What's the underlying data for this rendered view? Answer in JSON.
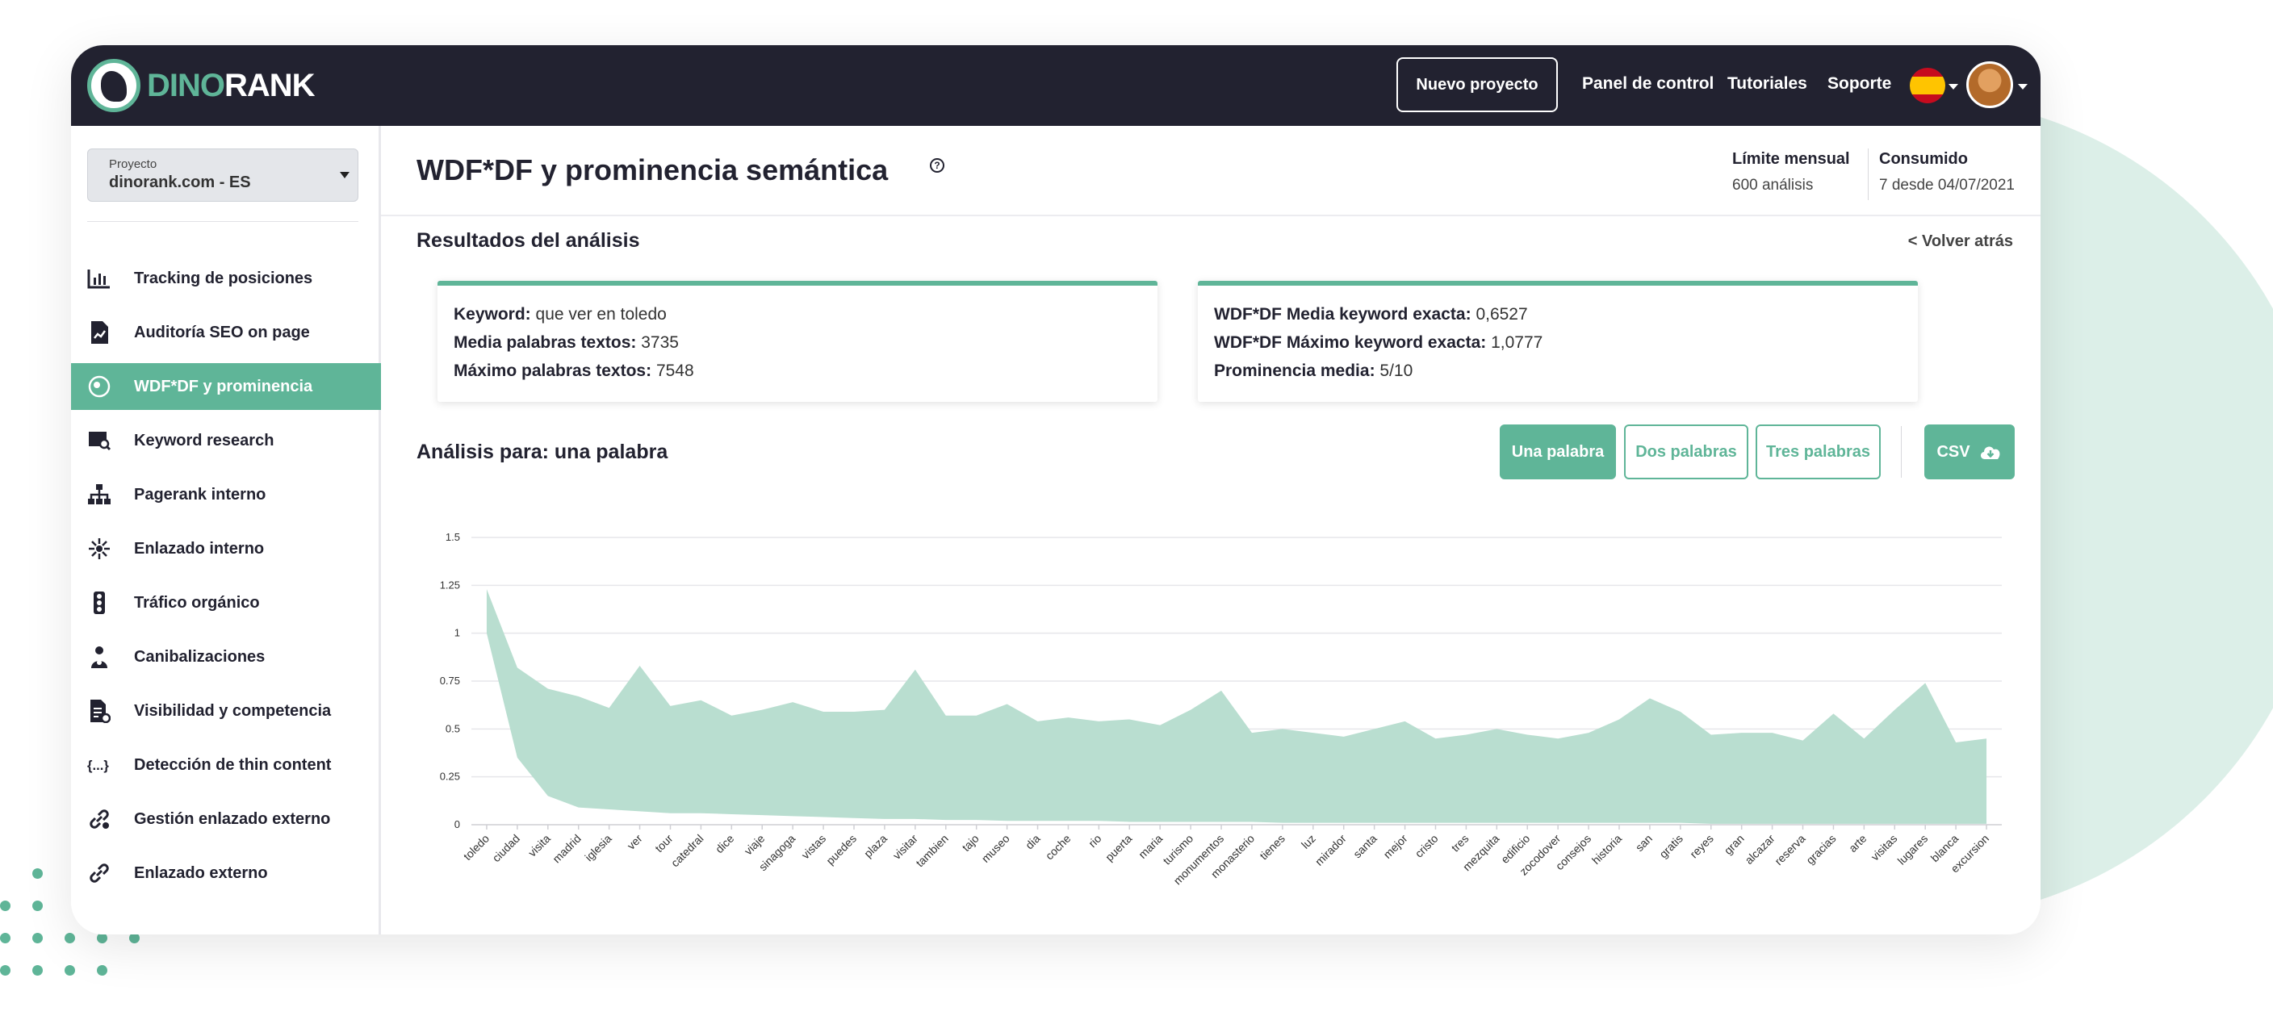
{
  "brand": {
    "logo_part_a": "DINO",
    "logo_part_b": "RANK",
    "accent": "#5fb598",
    "dark": "#222230"
  },
  "topbar": {
    "new_project": "Nuevo proyecto",
    "links": [
      "Panel de control",
      "Tutoriales",
      "Soporte"
    ],
    "icons": [
      "spain-flag-icon",
      "user-avatar"
    ]
  },
  "project": {
    "label": "Proyecto",
    "value": "dinorank.com - ES"
  },
  "sidebar": {
    "items": [
      {
        "label": "Tracking de posiciones",
        "icon": "bar-chart-icon"
      },
      {
        "label": "Auditoría SEO on page",
        "icon": "document-chart-icon"
      },
      {
        "label": "WDF*DF y prominencia",
        "icon": "target-icon",
        "active": true
      },
      {
        "label": "Keyword research",
        "icon": "search-chart-icon"
      },
      {
        "label": "Pagerank interno",
        "icon": "sitemap-icon"
      },
      {
        "label": "Enlazado interno",
        "icon": "network-icon"
      },
      {
        "label": "Tráfico orgánico",
        "icon": "traffic-light-icon"
      },
      {
        "label": "Canibalizaciones",
        "icon": "people-icon"
      },
      {
        "label": "Visibilidad y competencia",
        "icon": "report-icon"
      },
      {
        "label": "Detección de thin content",
        "icon": "braces-icon"
      },
      {
        "label": "Gestión enlazado externo",
        "icon": "link-gear-icon"
      },
      {
        "label": "Enlazado externo",
        "icon": "link-icon"
      }
    ]
  },
  "header": {
    "title": "WDF*DF y prominencia semántica",
    "help_icon": "?",
    "limit_label": "Límite mensual",
    "limit_value": "600 análisis",
    "consumed_label": "Consumido",
    "consumed_value": "7 desde 04/07/2021"
  },
  "results": {
    "title": "Resultados del análisis",
    "back": "< Volver atrás",
    "card1": [
      {
        "label": "Keyword:",
        "value": "que ver en toledo"
      },
      {
        "label": "Media palabras textos:",
        "value": "3735"
      },
      {
        "label": "Máximo palabras textos:",
        "value": "7548"
      }
    ],
    "card2": [
      {
        "label": "WDF*DF Media keyword exacta:",
        "value": "0,6527"
      },
      {
        "label": "WDF*DF Máximo keyword exacta:",
        "value": "1,0777"
      },
      {
        "label": "Prominencia media:",
        "value": "5/10"
      }
    ]
  },
  "analysis": {
    "title": "Análisis para: una palabra",
    "buttons": [
      {
        "label": "Una palabra",
        "selected": true
      },
      {
        "label": "Dos palabras",
        "selected": false
      },
      {
        "label": "Tres palabras",
        "selected": false
      }
    ],
    "csv_label": "CSV",
    "csv_icon": "cloud-download-icon"
  },
  "chart_data": {
    "type": "area",
    "ylim": [
      0,
      1.5
    ],
    "yticks": [
      "0",
      "0.25",
      "0.5",
      "0.75",
      "1",
      "1.25",
      "1.5"
    ],
    "ytick_values": [
      0,
      0.25,
      0.5,
      0.75,
      1,
      1.25,
      1.5
    ],
    "categories": [
      "toledo",
      "ciudad",
      "visita",
      "madrid",
      "iglesia",
      "ver",
      "tour",
      "catedral",
      "dice",
      "viaje",
      "sinagoga",
      "vistas",
      "puedes",
      "plaza",
      "visitar",
      "tambien",
      "tajo",
      "museo",
      "dia",
      "coche",
      "rio",
      "puerta",
      "maria",
      "turismo",
      "monumentos",
      "monasterio",
      "tienes",
      "luz",
      "mirador",
      "santa",
      "mejor",
      "cristo",
      "tres",
      "mezquita",
      "edificio",
      "zocodover",
      "consejos",
      "historia",
      "san",
      "gratis",
      "reyes",
      "gran",
      "alcazar",
      "reserva",
      "gracias",
      "arte",
      "visitas",
      "lugares",
      "blanca",
      "excursion"
    ],
    "series": [
      {
        "values": [
          1.23,
          0.82,
          0.71,
          0.67,
          0.61,
          0.83,
          0.62,
          0.65,
          0.57,
          0.6,
          0.64,
          0.59,
          0.59,
          0.6,
          0.81,
          0.57,
          0.57,
          0.63,
          0.54,
          0.56,
          0.54,
          0.55,
          0.52,
          0.6,
          0.7,
          0.48,
          0.5,
          0.48,
          0.46,
          0.5,
          0.54,
          0.45,
          0.47,
          0.5,
          0.47,
          0.45,
          0.48,
          0.55,
          0.66,
          0.59,
          0.47,
          0.48,
          0.48,
          0.44,
          0.58,
          0.45,
          0.6,
          0.74,
          0.43,
          0.45
        ]
      },
      {
        "values": [
          1.0,
          0.35,
          0.15,
          0.09,
          0.08,
          0.07,
          0.06,
          0.06,
          0.055,
          0.05,
          0.045,
          0.04,
          0.035,
          0.03,
          0.03,
          0.025,
          0.025,
          0.02,
          0.02,
          0.02,
          0.02,
          0.015,
          0.015,
          0.015,
          0.015,
          0.015,
          0.01,
          0.01,
          0.01,
          0.01,
          0.01,
          0.01,
          0.01,
          0.01,
          0.01,
          0.01,
          0.01,
          0.01,
          0.01,
          0.01,
          0.005,
          0.005,
          0.005,
          0.005,
          0.005,
          0.005,
          0.005,
          0.005,
          0.005,
          0.005
        ]
      }
    ],
    "colors": {
      "area": "#b9ded0",
      "grid": "#e6e6ea",
      "axis": "#cfcfd4"
    },
    "grid": true
  }
}
